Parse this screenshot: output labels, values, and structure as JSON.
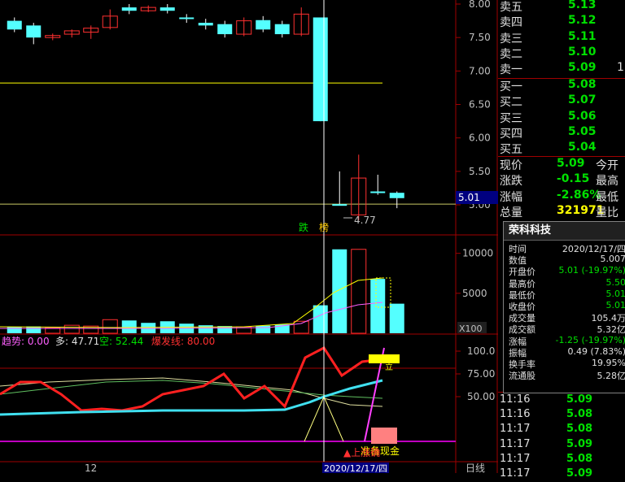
{
  "main_axis": {
    "ticks": [
      "8.00",
      "7.50",
      "7.00",
      "6.50",
      "6.00",
      "5.50",
      "5.00"
    ],
    "current": "5.01",
    "low_label": "4.77"
  },
  "markers": {
    "die": "跌",
    "bang": "榜"
  },
  "vol_axis": {
    "ticks": [
      "10000",
      "5000"
    ],
    "unit": "X100"
  },
  "indicator": {
    "trend_label": "趋势: 0.00",
    "duo_label": "多: 47.71",
    "kong_label": "空: 52.44",
    "bfx_label": "爆发线: 80.00",
    "ticks": [
      "100.0",
      "75.00",
      "50.00"
    ],
    "marker": "12",
    "up_confirm": "▲上涨确",
    "cash_label": "准备现金",
    "cash_arrow": "立"
  },
  "xaxis": {
    "month": "12",
    "date": "2020/12/17/四",
    "period": "日线"
  },
  "quote": {
    "sells": [
      {
        "label": "卖五",
        "price": "5.13"
      },
      {
        "label": "卖四",
        "price": "5.12"
      },
      {
        "label": "卖三",
        "price": "5.11"
      },
      {
        "label": "卖二",
        "price": "5.10"
      },
      {
        "label": "卖一",
        "price": "5.09",
        "vol": "1"
      }
    ],
    "buys": [
      {
        "label": "买一",
        "price": "5.08"
      },
      {
        "label": "买二",
        "price": "5.07"
      },
      {
        "label": "买三",
        "price": "5.06"
      },
      {
        "label": "买四",
        "price": "5.05"
      },
      {
        "label": "买五",
        "price": "5.04"
      }
    ],
    "stats": [
      {
        "label": "现价",
        "value": "5.09",
        "extra": "今开"
      },
      {
        "label": "涨跌",
        "value": "-0.15",
        "extra": "最高"
      },
      {
        "label": "涨幅",
        "value": "-2.86%",
        "extra": "最低"
      },
      {
        "label": "总量",
        "value": "321971",
        "extra": "量比"
      }
    ]
  },
  "popup": {
    "title": "荣科科技",
    "rows": [
      {
        "label": "时间",
        "value": "2020/12/17/四",
        "color": "#e0e0e0"
      },
      {
        "label": "数值",
        "value": "5.007",
        "color": "#e0e0e0"
      },
      {
        "label": "开盘价",
        "value": "5.01 (-19.97%)",
        "color": "#00e000"
      },
      {
        "label": "最高价",
        "value": "5.50",
        "color": "#00e000"
      },
      {
        "label": "最低价",
        "value": "5.01",
        "color": "#00e000"
      },
      {
        "label": "收盘价",
        "value": "5.01",
        "color": "#00e000"
      },
      {
        "label": "成交量",
        "value": "105.4万",
        "color": "#e0e0e0"
      },
      {
        "label": "成交额",
        "value": "5.32亿",
        "color": "#e0e0e0"
      },
      {
        "label": "涨幅",
        "value": "-1.25 (-19.97%)",
        "color": "#00e000"
      },
      {
        "label": "振幅",
        "value": "0.49 (7.83%)",
        "color": "#e0e0e0"
      },
      {
        "label": "换手率",
        "value": "19.95%",
        "color": "#e0e0e0"
      },
      {
        "label": "流通股",
        "value": "5.28亿",
        "color": "#e0e0e0"
      }
    ]
  },
  "ticks_list": [
    {
      "time": "11:16",
      "price": "5.09"
    },
    {
      "time": "11:16",
      "price": "5.08"
    },
    {
      "time": "11:17",
      "price": "5.08"
    },
    {
      "time": "11:17",
      "price": "5.09"
    },
    {
      "time": "11:17",
      "price": "5.08"
    },
    {
      "time": "11:17",
      "price": "5.09"
    }
  ],
  "colors": {
    "up": "#ff3030",
    "down": "#54ffff",
    "ma": "#ffff00",
    "bg": "#000000",
    "grid": "#a00000"
  },
  "chart_data": {
    "type": "candlestick",
    "ylim": [
      4.85,
      8.05
    ],
    "candles": [
      {
        "o": 7.75,
        "c": 7.62,
        "h": 7.8,
        "l": 7.58
      },
      {
        "o": 7.68,
        "c": 7.5,
        "h": 7.72,
        "l": 7.4
      },
      {
        "o": 7.5,
        "c": 7.53,
        "h": 7.56,
        "l": 7.46
      },
      {
        "o": 7.55,
        "c": 7.6,
        "h": 7.62,
        "l": 7.5
      },
      {
        "o": 7.58,
        "c": 7.64,
        "h": 7.68,
        "l": 7.48
      },
      {
        "o": 7.65,
        "c": 7.82,
        "h": 7.92,
        "l": 7.62
      },
      {
        "o": 7.95,
        "c": 7.9,
        "h": 8.0,
        "l": 7.85
      },
      {
        "o": 7.9,
        "c": 7.95,
        "h": 7.98,
        "l": 7.88
      },
      {
        "o": 7.95,
        "c": 7.9,
        "h": 8.0,
        "l": 7.86
      },
      {
        "o": 7.8,
        "c": 7.78,
        "h": 7.85,
        "l": 7.72
      },
      {
        "o": 7.72,
        "c": 7.68,
        "h": 7.78,
        "l": 7.62
      },
      {
        "o": 7.7,
        "c": 7.55,
        "h": 7.75,
        "l": 7.5
      },
      {
        "o": 7.55,
        "c": 7.75,
        "h": 7.8,
        "l": 7.52
      },
      {
        "o": 7.76,
        "c": 7.62,
        "h": 7.82,
        "l": 7.58
      },
      {
        "o": 7.7,
        "c": 7.55,
        "h": 7.75,
        "l": 7.5
      },
      {
        "o": 7.55,
        "c": 7.85,
        "h": 7.95,
        "l": 7.52
      },
      {
        "o": 7.8,
        "c": 6.25,
        "h": 7.8,
        "l": 6.25
      },
      {
        "o": 5.01,
        "c": 5.01,
        "h": 5.5,
        "l": 5.01
      },
      {
        "o": 4.85,
        "c": 5.4,
        "h": 5.75,
        "l": 4.77
      },
      {
        "o": 5.2,
        "c": 5.2,
        "h": 5.45,
        "l": 5.15
      },
      {
        "o": 5.18,
        "c": 5.1,
        "h": 5.2,
        "l": 4.95
      }
    ],
    "ma": [
      {
        "x": 0,
        "y": 6.82
      },
      {
        "x": 19,
        "y": 6.82
      }
    ],
    "volume": {
      "ylim": [
        0,
        12000
      ],
      "values": [
        800,
        850,
        700,
        1000,
        900,
        1700,
        1600,
        1300,
        1500,
        1200,
        1000,
        900,
        800,
        950,
        1100,
        1500,
        3500,
        10500,
        10500,
        6800,
        3700
      ],
      "up": [
        false,
        false,
        true,
        true,
        true,
        true,
        false,
        false,
        false,
        false,
        false,
        false,
        true,
        false,
        false,
        true,
        false,
        false,
        true,
        false,
        false
      ]
    },
    "indicator": {
      "ylim": [
        0,
        110
      ],
      "red": [
        55,
        60,
        50,
        55,
        45,
        30,
        30,
        28,
        35,
        42,
        50,
        55,
        70,
        50,
        55,
        65,
        45,
        95,
        100,
        75,
        85,
        88
      ],
      "cyan": [
        0,
        5,
        10,
        14,
        16,
        18,
        20,
        22,
        25,
        30,
        40,
        52,
        60,
        65,
        68
      ],
      "thin1": [
        62,
        61,
        58,
        52,
        48,
        45
      ],
      "thin2": [
        48,
        49,
        52,
        55,
        55,
        53
      ]
    }
  }
}
